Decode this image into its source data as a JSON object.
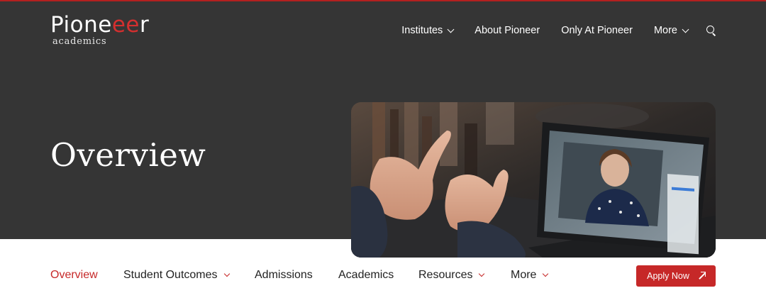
{
  "brand": {
    "name_part1": "Pione",
    "name_accent": "ee",
    "name_part2": "r",
    "tagline": "academics",
    "accent_color": "#d32f2f"
  },
  "topnav": {
    "items": [
      {
        "label": "Institutes",
        "has_dropdown": true
      },
      {
        "label": "About Pioneer",
        "has_dropdown": false
      },
      {
        "label": "Only At Pioneer",
        "has_dropdown": false
      },
      {
        "label": "More",
        "has_dropdown": true
      }
    ],
    "search_icon": "search-icon"
  },
  "hero": {
    "title": "Overview",
    "background_color": "#353535",
    "image_icon": "video-call-photo"
  },
  "subnav": {
    "tabs": [
      {
        "label": "Overview",
        "active": true,
        "has_dropdown": false
      },
      {
        "label": "Student Outcomes",
        "active": false,
        "has_dropdown": true
      },
      {
        "label": "Admissions",
        "active": false,
        "has_dropdown": false
      },
      {
        "label": "Academics",
        "active": false,
        "has_dropdown": false
      },
      {
        "label": "Resources",
        "active": false,
        "has_dropdown": true
      },
      {
        "label": "More",
        "active": false,
        "has_dropdown": true
      }
    ],
    "active_color": "#c62828"
  },
  "cta": {
    "apply_label": "Apply Now",
    "icon": "arrow-up-right-icon",
    "color": "#c62828"
  }
}
